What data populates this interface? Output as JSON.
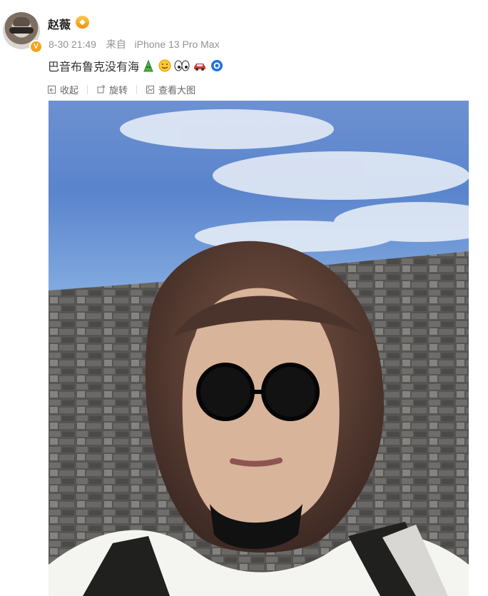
{
  "post": {
    "author": "赵薇",
    "timestamp": "8-30 21:49",
    "source_prefix": "来自",
    "source": "iPhone 13 Pro Max",
    "text": "巴音布鲁克没有海",
    "emojis": [
      "green-face-emoji",
      "smile-emoji",
      "eyes-emoji",
      "car-emoji",
      "blue-ring-emoji"
    ]
  },
  "actions": {
    "collapse": "收起",
    "rotate": "旋转",
    "view_large": "查看大图"
  },
  "colors": {
    "meta": "#939393",
    "badge": "#f7a21b",
    "sky": "#5f86cc",
    "wall": "#5e5d5c"
  }
}
